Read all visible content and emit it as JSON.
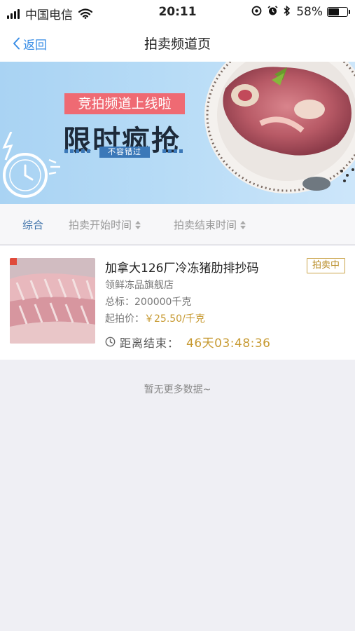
{
  "status_bar": {
    "carrier": "中国电信",
    "time": "20:11",
    "battery": "58%",
    "battery_level": 0.58,
    "icons": [
      "signal-icon",
      "wifi-icon",
      "location-icon",
      "alarm-icon",
      "bluetooth-icon",
      "battery-icon"
    ]
  },
  "nav": {
    "back_label": "返回",
    "title": "拍卖频道页"
  },
  "banner": {
    "tag": "竞拍频道上线啦",
    "headline": "限时疯抢",
    "subtitle": "不容错过"
  },
  "sort_bar": {
    "items": [
      {
        "label": "综合",
        "active": true
      },
      {
        "label": "拍卖开始时间",
        "active": false
      },
      {
        "label": "拍卖结束时间",
        "active": false
      }
    ]
  },
  "listing": {
    "title": "加拿大126厂冷冻猪肋排抄码",
    "status": "拍卖中",
    "shop": "领鲜冻品旗舰店",
    "total_label": "总标：",
    "total_value": "200000千克",
    "price_label": "起拍价：",
    "price_value": "￥25.50/千克",
    "countdown_label": "距离结束：",
    "countdown_value": "46天03:48:36"
  },
  "footer_text": "暂无更多数据~",
  "colors": {
    "accent_blue": "#3a8ee6",
    "gold": "#c79a32",
    "banner_pink": "#ef6a73",
    "background": "#efeff4"
  }
}
